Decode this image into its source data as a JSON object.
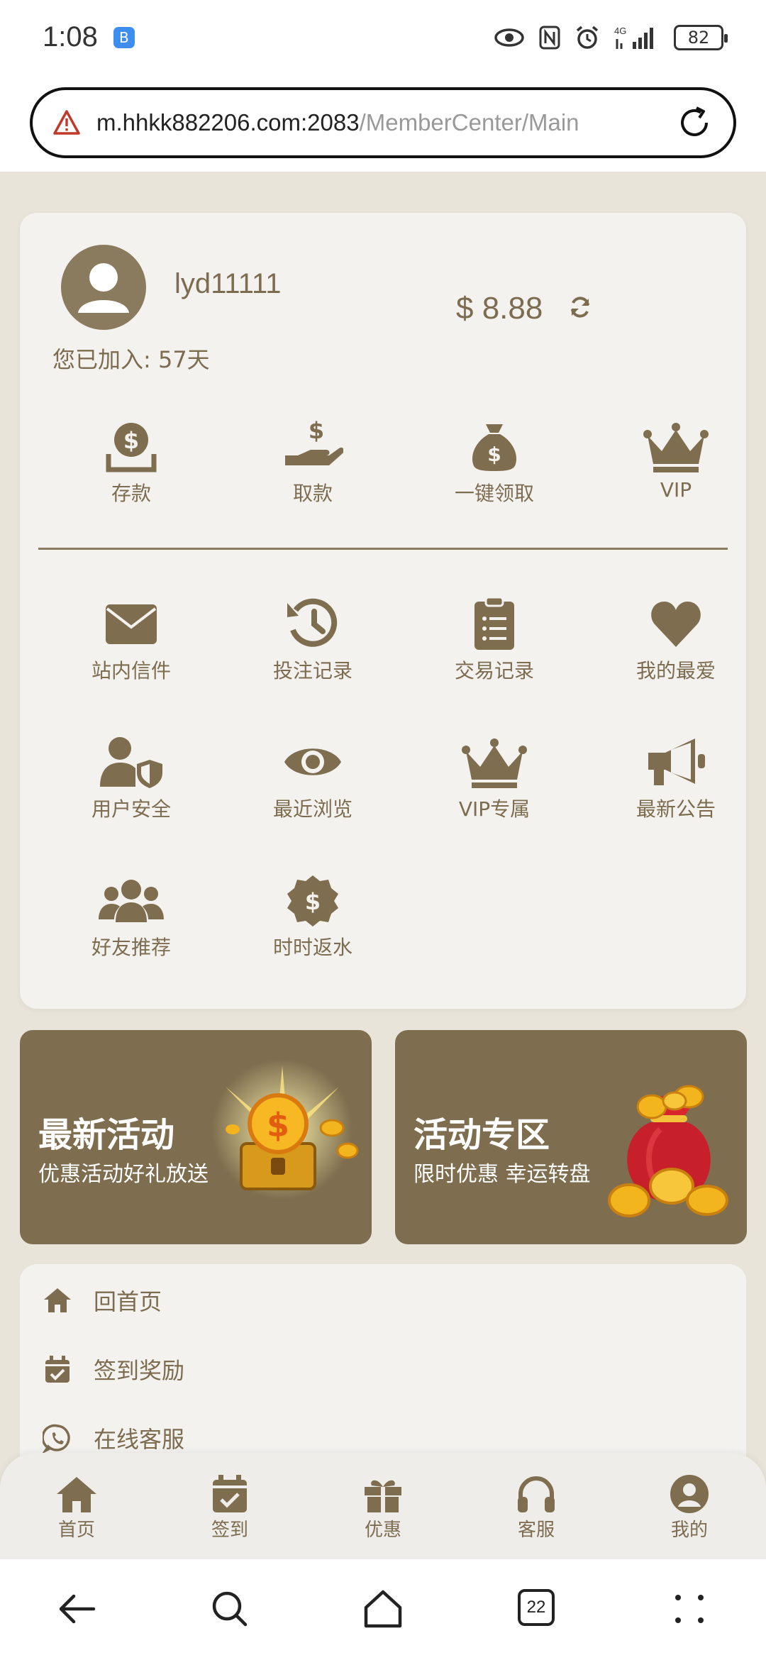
{
  "status_bar": {
    "time": "1:08",
    "battery": "82",
    "network": "4G"
  },
  "browser": {
    "url_host": "m.hhkk882206.com:2083",
    "url_path": "/MemberCenter/Main",
    "tab_count": "22"
  },
  "profile": {
    "username": "lyd11111",
    "joined": "您已加入: 57天",
    "balance": "$ 8.88"
  },
  "quick_actions": [
    {
      "label": "存款",
      "icon": "deposit-icon"
    },
    {
      "label": "取款",
      "icon": "withdraw-icon"
    },
    {
      "label": "一键领取",
      "icon": "money-bag-icon"
    },
    {
      "label": "VIP",
      "icon": "crown-icon"
    }
  ],
  "features": [
    {
      "label": "站内信件",
      "icon": "mail-icon"
    },
    {
      "label": "投注记录",
      "icon": "history-icon"
    },
    {
      "label": "交易记录",
      "icon": "clipboard-icon"
    },
    {
      "label": "我的最爱",
      "icon": "heart-icon"
    },
    {
      "label": "用户安全",
      "icon": "user-shield-icon"
    },
    {
      "label": "最近浏览",
      "icon": "eye-icon"
    },
    {
      "label": "VIP专属",
      "icon": "crown-icon"
    },
    {
      "label": "最新公告",
      "icon": "megaphone-icon"
    },
    {
      "label": "好友推荐",
      "icon": "users-icon"
    },
    {
      "label": "时时返水",
      "icon": "dollar-badge-icon"
    }
  ],
  "promos": [
    {
      "title": "最新活动",
      "subtitle": "优惠活动好礼放送"
    },
    {
      "title": "活动专区",
      "subtitle": "限时优惠 幸运转盘"
    }
  ],
  "menu": [
    {
      "label": "回首页",
      "icon": "home-icon"
    },
    {
      "label": "签到奖励",
      "icon": "calendar-check-icon"
    },
    {
      "label": "在线客服",
      "icon": "whatsapp-icon"
    }
  ],
  "tabs": [
    {
      "label": "首页",
      "icon": "home-icon"
    },
    {
      "label": "签到",
      "icon": "calendar-check-icon"
    },
    {
      "label": "优惠",
      "icon": "gift-icon"
    },
    {
      "label": "客服",
      "icon": "headphones-icon"
    },
    {
      "label": "我的",
      "icon": "user-circle-icon"
    }
  ],
  "colors": {
    "accent": "#7e6d4e",
    "page_bg": "#e8e4d9",
    "card_bg": "#f3f2ef"
  }
}
